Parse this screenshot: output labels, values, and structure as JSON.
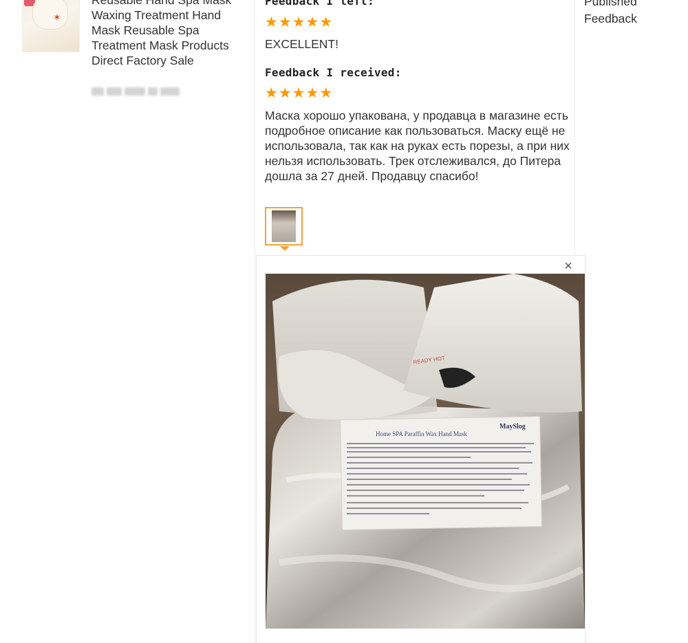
{
  "product": {
    "thumbnail_icon": "paraffin-hand-mask-product-photo",
    "title": "Reusable Hand Spa Mask Waxing Treatment Hand Mask Reusable Spa Treatment Mask Products Direct Factory Sale"
  },
  "feedback": {
    "left_heading": "Feedback I left:",
    "left_rating": 5,
    "left_text": "EXCELLENT!",
    "received_heading": "Feedback I received:",
    "received_rating": 5,
    "received_text": "Маска хорошо упакована, у продавца в магазине есть подробное описание как пользоваться. Маску ещё не использовала, так как на руках есть порезы, а при них нельзя использовать. Трек отслеживался, до Питера дошла за 27 дней. Продавцу спасибо!",
    "photo_thumbnail_icon": "review-photo-thumbnail",
    "star_color": "#ff9900",
    "accent_color": "#f2a33a"
  },
  "preview": {
    "close_label": "×",
    "photo_icon": "paraffin-mask-package-photo",
    "label_title": "Home SPA Paraffin Wax Hand Mask",
    "brand": "MaySlog",
    "glove_stamp": "READY HOT"
  },
  "status": {
    "published_label": "Published Feedback"
  }
}
